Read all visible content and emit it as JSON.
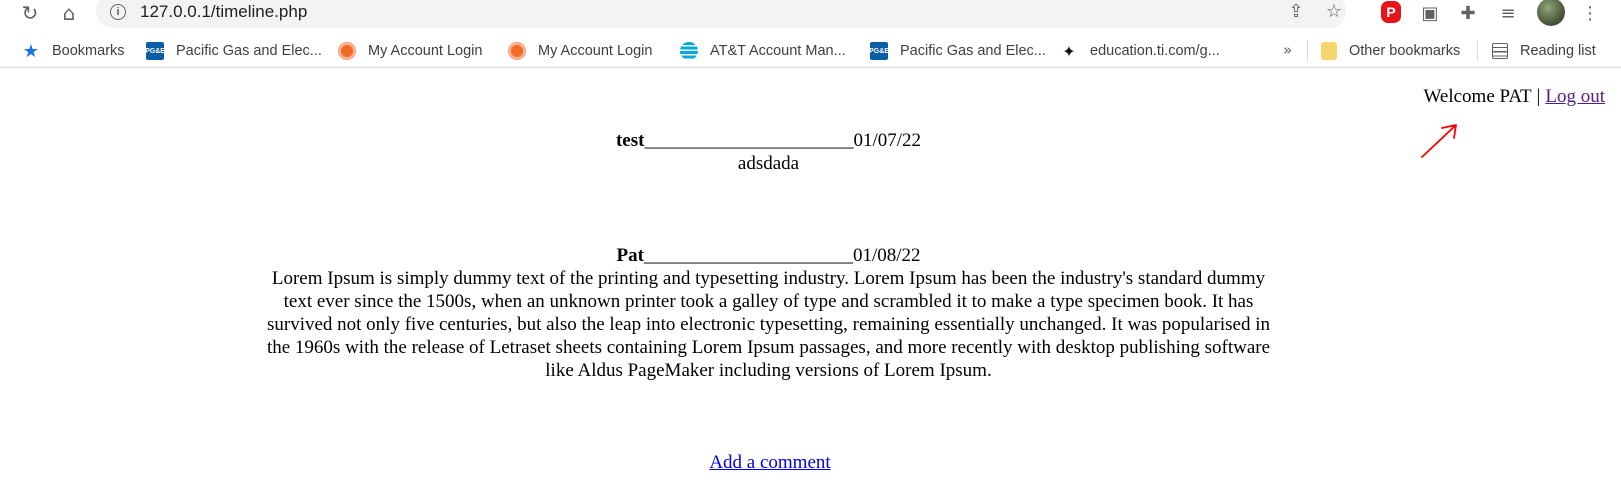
{
  "browser": {
    "url": "127.0.0.1/timeline.php",
    "ext_red_label": "P"
  },
  "bookmarks_bar": {
    "items": [
      {
        "label": "Bookmarks",
        "icon": "star-icon"
      },
      {
        "label": "Pacific Gas and Elec...",
        "icon": "pge-icon"
      },
      {
        "label": "My Account Login",
        "icon": "orange-circle-icon"
      },
      {
        "label": "My Account Login",
        "icon": "orange-circle-icon"
      },
      {
        "label": "AT&T Account Man...",
        "icon": "att-globe-icon"
      },
      {
        "label": "Pacific Gas and Elec...",
        "icon": "pge-icon"
      },
      {
        "label": "education.ti.com/g...",
        "icon": "texas-instruments-icon"
      }
    ],
    "overflow": "»",
    "other_bookmarks": "Other bookmarks",
    "reading_list": "Reading list"
  },
  "page": {
    "welcome_text": "Welcome PAT",
    "separator": "|",
    "logout_label": "Log out",
    "posts": [
      {
        "author": "test",
        "underline": "______________________",
        "date": "01/07/22",
        "body": "adsdada"
      },
      {
        "author": "Pat",
        "underline": "______________________",
        "date": "01/08/22",
        "body": "Lorem Ipsum is simply dummy text of the printing and typesetting industry. Lorem Ipsum has been the industry's standard dummy text ever since the 1500s, when an unknown printer took a galley of type and scrambled it to make a type specimen book. It has survived not only five centuries, but also the leap into electronic typesetting, remaining essentially unchanged. It was popularised in the 1960s with the release of Letraset sheets containing Lorem Ipsum passages, and more recently with desktop publishing software like Aldus PageMaker including versions of Lorem Ipsum."
      }
    ],
    "add_comment_label": "Add a comment"
  },
  "colors": {
    "annotation_arrow": "#ff0000",
    "visited_link": "#551a8b",
    "link": "#0000ee"
  }
}
